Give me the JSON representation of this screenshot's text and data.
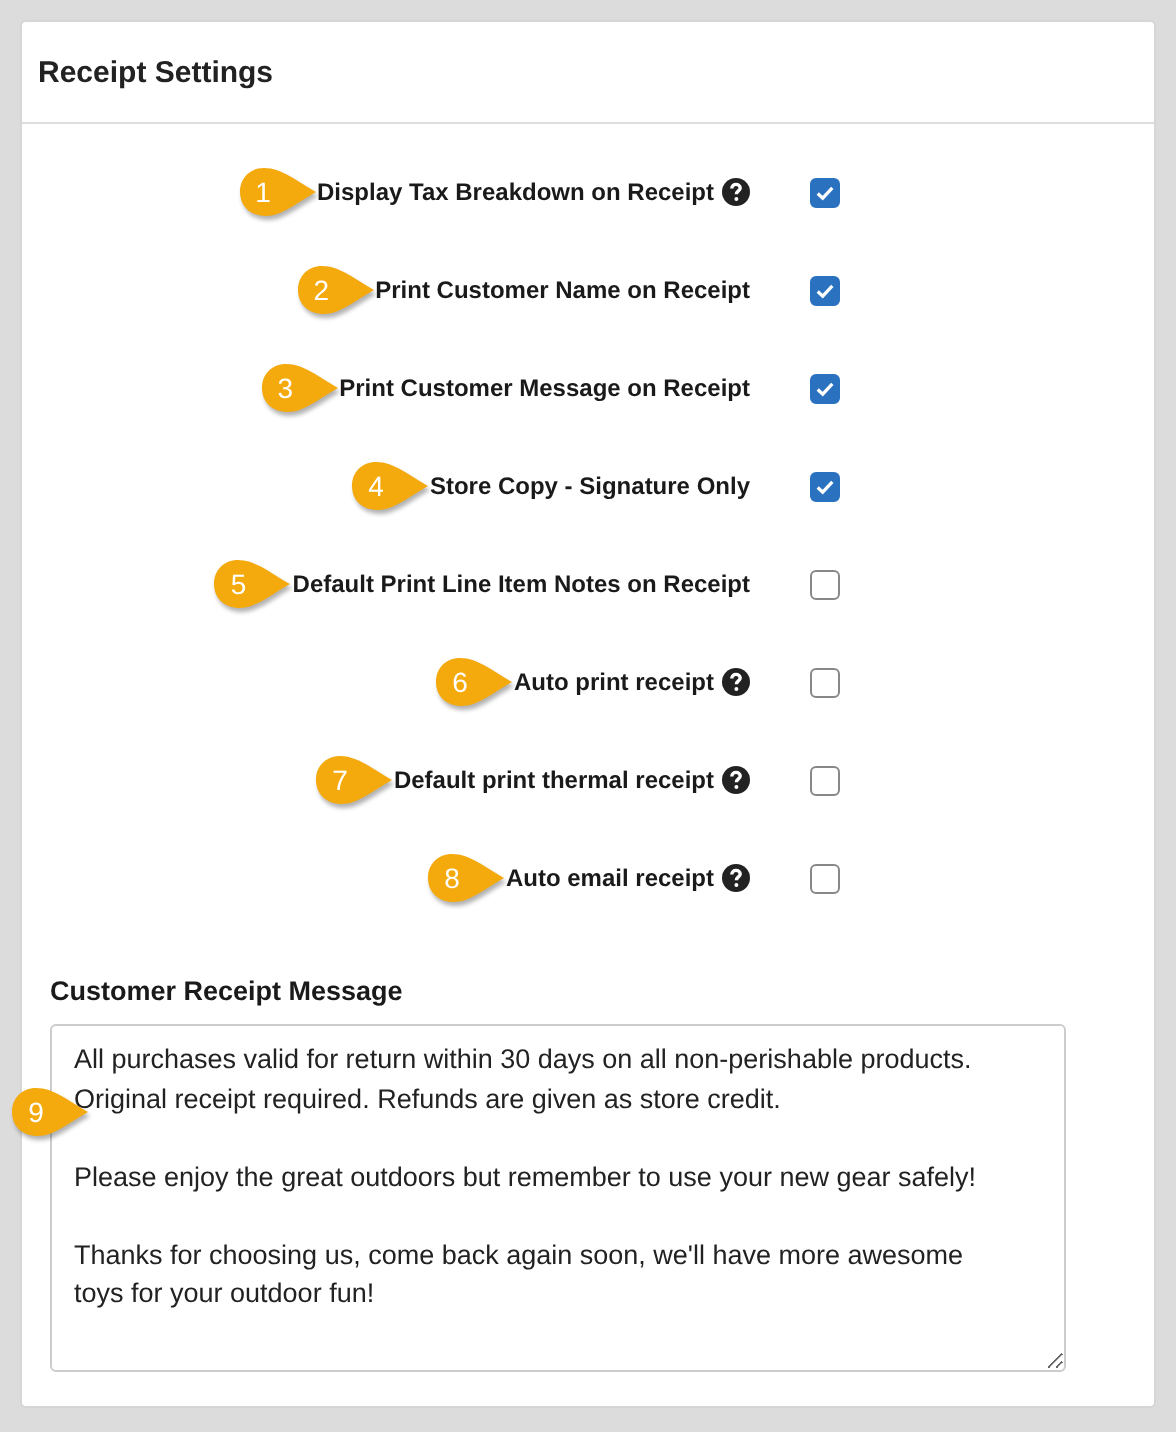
{
  "panel": {
    "title": "Receipt Settings"
  },
  "settings": [
    {
      "callout": "1",
      "label": "Display Tax Breakdown on Receipt",
      "help": true,
      "checked": true
    },
    {
      "callout": "2",
      "label": "Print Customer Name on Receipt",
      "help": false,
      "checked": true
    },
    {
      "callout": "3",
      "label": "Print Customer Message on Receipt",
      "help": false,
      "checked": true
    },
    {
      "callout": "4",
      "label": "Store Copy - Signature Only",
      "help": false,
      "checked": true
    },
    {
      "callout": "5",
      "label": "Default Print Line Item Notes on Receipt",
      "help": false,
      "checked": false
    },
    {
      "callout": "6",
      "label": "Auto print receipt",
      "help": true,
      "checked": false
    },
    {
      "callout": "7",
      "label": "Default print thermal receipt",
      "help": true,
      "checked": false
    },
    {
      "callout": "8",
      "label": "Auto email receipt",
      "help": true,
      "checked": false
    }
  ],
  "message": {
    "label": "Customer Receipt Message",
    "callout": "9",
    "value": "All purchases valid for return within 30 days on all non-perishable products. Original receipt required. Refunds are given as store credit.\n\nPlease enjoy the great outdoors but remember to use your new gear safely!\n\nThanks for choosing us, come back again soon, we'll have more awesome toys for your outdoor fun!"
  }
}
